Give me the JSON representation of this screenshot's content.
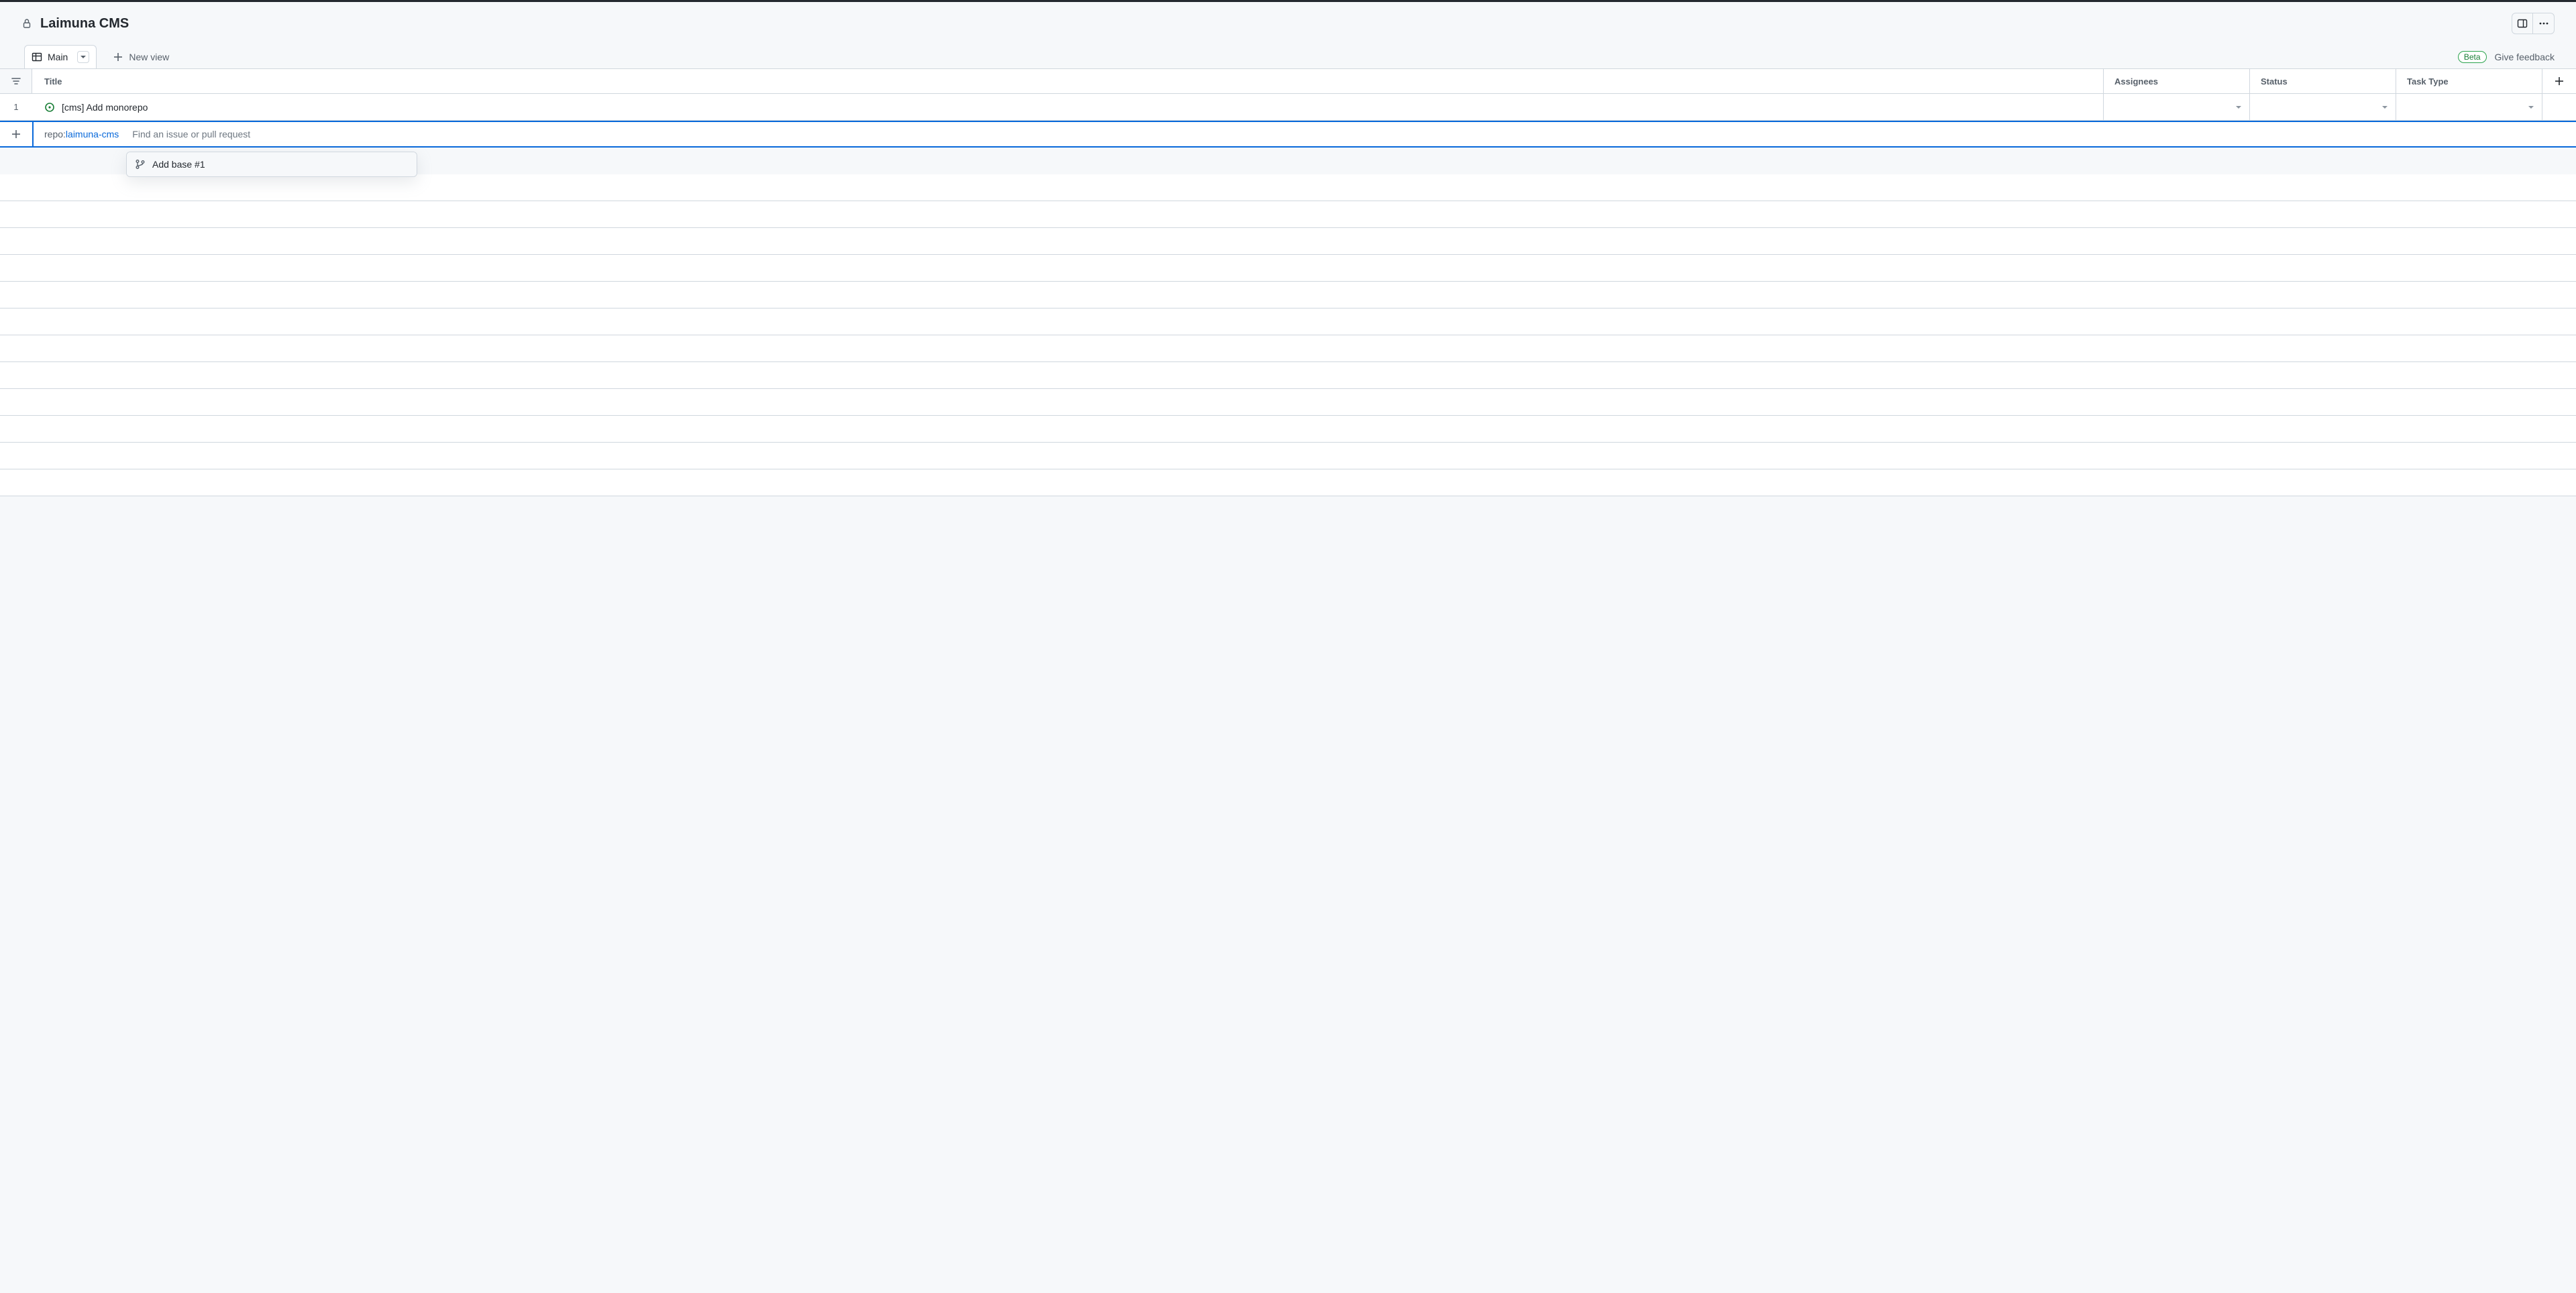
{
  "header": {
    "title": "Laimuna CMS"
  },
  "tabs": {
    "active": "Main",
    "new_view": "New view"
  },
  "badges": {
    "beta": "Beta",
    "feedback": "Give feedback"
  },
  "columns": {
    "title": "Title",
    "assignees": "Assignees",
    "status": "Status",
    "task_type": "Task Type"
  },
  "rows": [
    {
      "num": "1",
      "title": "[cms] Add monorepo"
    }
  ],
  "add_row": {
    "repo_prefix": "repo:",
    "repo_name": "laimuna-cms",
    "placeholder": "Find an issue or pull request"
  },
  "suggestion": {
    "label": "Add base #1"
  }
}
